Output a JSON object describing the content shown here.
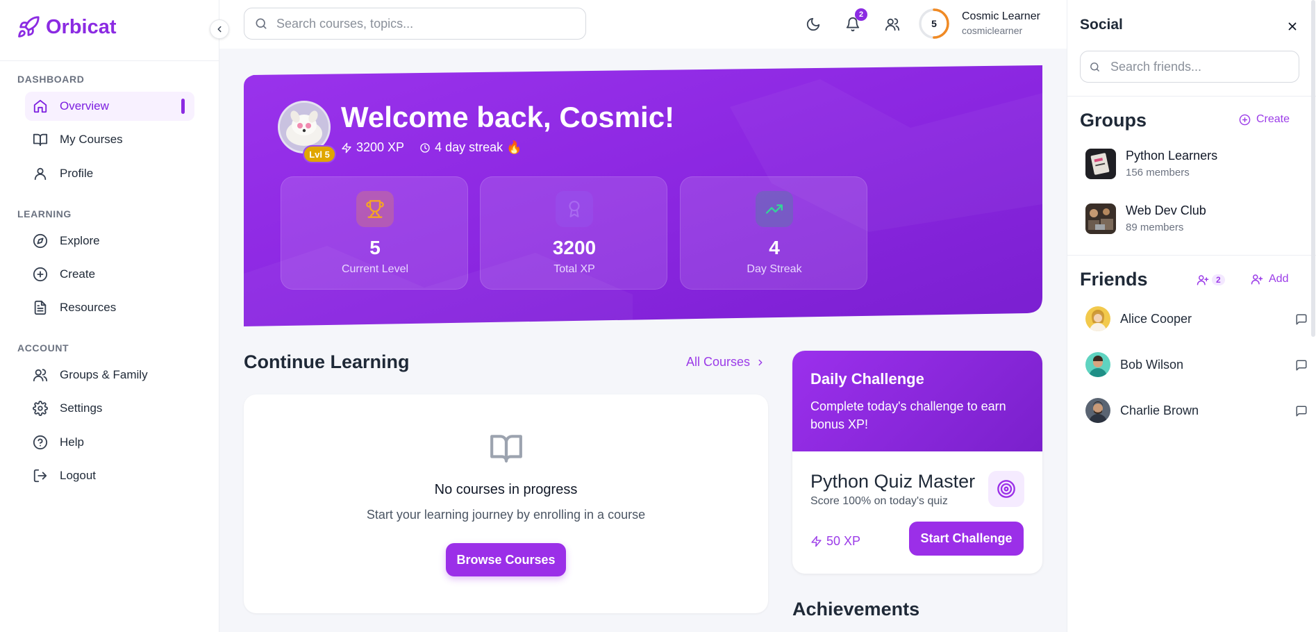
{
  "app": {
    "name": "Orbicat"
  },
  "sidebar": {
    "sections": [
      {
        "label": "DASHBOARD",
        "items": [
          {
            "label": "Overview",
            "icon": "home-icon",
            "active": true
          },
          {
            "label": "My Courses",
            "icon": "book-open-icon"
          },
          {
            "label": "Profile",
            "icon": "user-icon"
          }
        ]
      },
      {
        "label": "LEARNING",
        "items": [
          {
            "label": "Explore",
            "icon": "compass-icon"
          },
          {
            "label": "Create",
            "icon": "plus-circle-icon"
          },
          {
            "label": "Resources",
            "icon": "file-text-icon"
          }
        ]
      },
      {
        "label": "ACCOUNT",
        "items": [
          {
            "label": "Groups & Family",
            "icon": "users-icon"
          },
          {
            "label": "Settings",
            "icon": "gear-icon"
          },
          {
            "label": "Help",
            "icon": "help-circle-icon"
          },
          {
            "label": "Logout",
            "icon": "logout-icon"
          }
        ]
      }
    ]
  },
  "topbar": {
    "search_placeholder": "Search courses, topics...",
    "notifications_count": "2",
    "user": {
      "level": "5",
      "name": "Cosmic Learner",
      "handle": "cosmiclearner",
      "level_progress": 0.5
    }
  },
  "hero": {
    "title": "Welcome back, Cosmic!",
    "level_badge": "Lvl 5",
    "xp_text": "3200 XP",
    "streak_text": "4 day streak 🔥",
    "stats": [
      {
        "value": "5",
        "label": "Current Level",
        "icon": "trophy-icon"
      },
      {
        "value": "3200",
        "label": "Total XP",
        "icon": "award-icon"
      },
      {
        "value": "4",
        "label": "Day Streak",
        "icon": "trending-up-icon"
      }
    ]
  },
  "continue_learning": {
    "title": "Continue Learning",
    "all_link": "All Courses",
    "empty_title": "No courses in progress",
    "empty_sub": "Start your learning journey by enrolling in a course",
    "browse_button": "Browse Courses"
  },
  "daily_challenge": {
    "title": "Daily Challenge",
    "description": "Complete today's challenge to earn bonus XP!",
    "quiz_title": "Python Quiz Master",
    "quiz_sub": "Score 100% on today's quiz",
    "xp": "50 XP",
    "button": "Start Challenge"
  },
  "achievements": {
    "title": "Achievements"
  },
  "social": {
    "title": "Social",
    "search_placeholder": "Search friends...",
    "groups_title": "Groups",
    "create_label": "Create",
    "groups": [
      {
        "name": "Python Learners",
        "members": "156 members"
      },
      {
        "name": "Web Dev Club",
        "members": "89 members"
      }
    ],
    "friends_title": "Friends",
    "requests_count": "2",
    "add_label": "Add",
    "friends": [
      {
        "name": "Alice Cooper"
      },
      {
        "name": "Bob Wilson"
      },
      {
        "name": "Charlie Brown"
      }
    ]
  }
}
